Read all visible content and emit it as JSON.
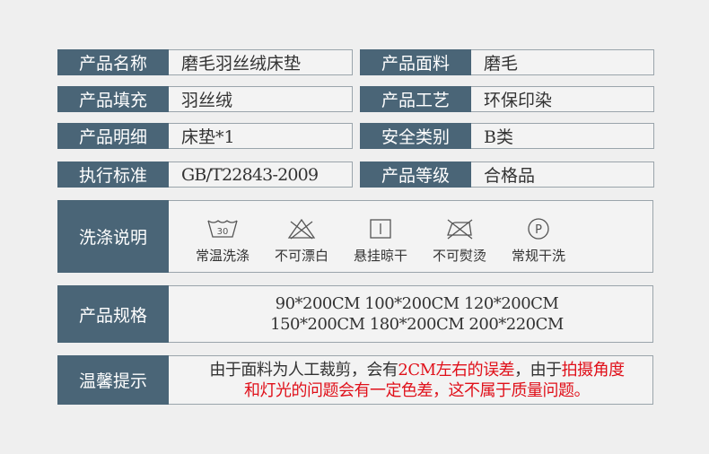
{
  "rows": [
    {
      "left_label": "产品名称",
      "left_value": "磨毛羽丝绒床垫",
      "right_label": "产品面料",
      "right_value": "磨毛"
    },
    {
      "left_label": "产品填充",
      "left_value": "羽丝绒",
      "right_label": "产品工艺",
      "right_value": "环保印染"
    },
    {
      "left_label": "产品明细",
      "left_value": "床垫*1",
      "right_label": "安全类别",
      "right_value": "B类"
    },
    {
      "left_label": "执行标准",
      "left_value": "GB/T22843-2009",
      "right_label": "产品等级",
      "right_value": "合格品"
    }
  ],
  "care": {
    "label": "洗涤说明",
    "items": [
      {
        "icon": "wash-30-icon",
        "text": "常温洗涤",
        "mark": "30"
      },
      {
        "icon": "no-bleach-icon",
        "text": "不可漂白"
      },
      {
        "icon": "hang-dry-icon",
        "text": "悬挂晾干"
      },
      {
        "icon": "no-iron-icon",
        "text": "不可熨烫"
      },
      {
        "icon": "dry-clean-icon",
        "text": "常规干洗",
        "mark": "P"
      }
    ]
  },
  "spec": {
    "label": "产品规格",
    "lines": [
      "90*200CM 100*200CM 120*200CM",
      "150*200CM 180*200CM 200*220CM"
    ]
  },
  "tips": {
    "label": "温馨提示",
    "line1_a": "由于面料为人工裁剪，会有",
    "line1_b": "2CM左右的误差",
    "line1_c": "，由于",
    "line1_d": "拍摄角度",
    "line2_a": "和灯光的问题会有一定色差，这不属于质量问题。"
  },
  "colors": {
    "label_bg": "#4a6577",
    "value_bg": "#f3f3f3",
    "accent_red": "#e0101a"
  }
}
